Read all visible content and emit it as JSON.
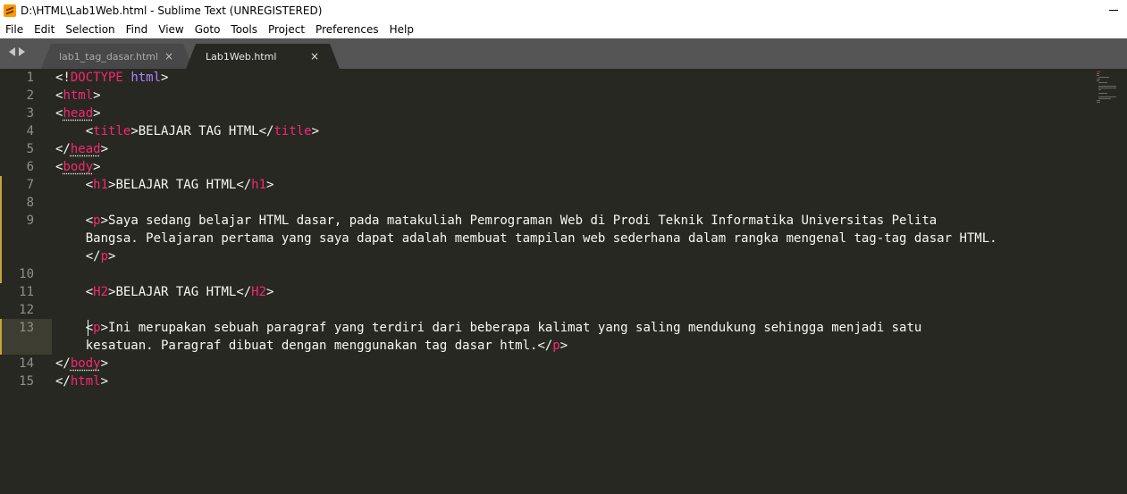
{
  "window": {
    "title": "D:\\HTML\\Lab1Web.html - Sublime Text (UNREGISTERED)"
  },
  "menu": [
    "File",
    "Edit",
    "Selection",
    "Find",
    "View",
    "Goto",
    "Tools",
    "Project",
    "Preferences",
    "Help"
  ],
  "tabs": [
    {
      "label": "lab1_tag_dasar.html",
      "active": false
    },
    {
      "label": "Lab1Web.html",
      "active": true
    }
  ],
  "editor": {
    "current_line": 13,
    "lines": [
      {
        "num": "1",
        "text": "<!DOCTYPE html>"
      },
      {
        "num": "2",
        "text": "<html>"
      },
      {
        "num": "3",
        "text": "<head>"
      },
      {
        "num": "4",
        "text": "    <title>BELAJAR TAG HTML</title>"
      },
      {
        "num": "5",
        "text": "</head>"
      },
      {
        "num": "6",
        "text": "<body>"
      },
      {
        "num": "7",
        "text": "    <h1>BELAJAR TAG HTML</h1>"
      },
      {
        "num": "8",
        "text": ""
      },
      {
        "num": "9",
        "text": "    <p>Saya sedang belajar HTML dasar, pada matakuliah Pemrograman Web di Prodi Teknik Informatika Universitas Pelita Bangsa. Pelajaran pertama yang saya dapat adalah membuat tampilan web sederhana dalam rangka mengenal tag-tag dasar HTML.</p>"
      },
      {
        "num": "10",
        "text": ""
      },
      {
        "num": "11",
        "text": "    <H2>BELAJAR TAG HTML</H2>"
      },
      {
        "num": "12",
        "text": ""
      },
      {
        "num": "13",
        "text": "    <p>Ini merupakan sebuah paragraf yang terdiri dari beberapa kalimat yang saling mendukung sehingga menjadi satu kesatuan. Paragraf dibuat dengan menggunakan tag dasar html.</p>"
      },
      {
        "num": "14",
        "text": "</body>"
      },
      {
        "num": "15",
        "text": "</html>"
      }
    ],
    "colors": {
      "background": "#272822",
      "tag": "#f92672",
      "keyword": "#ae81ff",
      "text": "#f8f8f2",
      "line_number": "#8f908a",
      "modified_marker": "#c7a23a"
    }
  }
}
